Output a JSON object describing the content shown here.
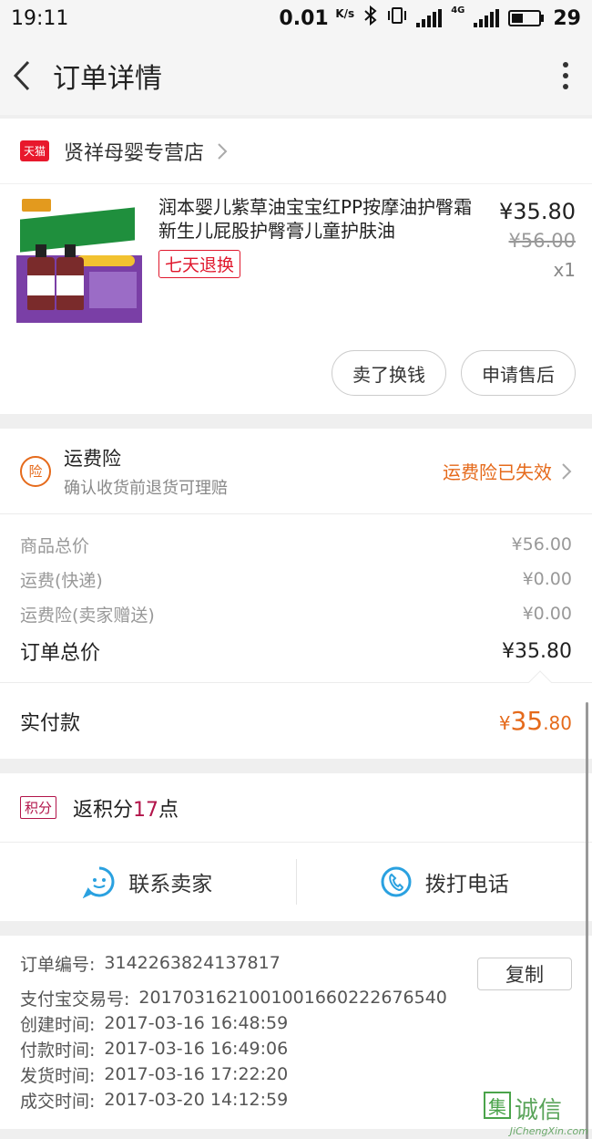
{
  "statusbar": {
    "time": "19:11",
    "speed_value": "0.01",
    "speed_unit": "K/s",
    "network": "4G",
    "battery": "29"
  },
  "header": {
    "title": "订单详情"
  },
  "shop": {
    "badge": "天猫",
    "name": "贤祥母婴专营店"
  },
  "product": {
    "title": "润本婴儿紫草油宝宝红PP按摩油护臀霜新生儿屁股护臀膏儿童护肤油",
    "tag": "七天退换",
    "price": "¥35.80",
    "original_price": "¥56.00",
    "quantity": "x1"
  },
  "actions": {
    "sell": "卖了换钱",
    "after_sale": "申请售后"
  },
  "insurance": {
    "icon_text": "险",
    "title": "运费险",
    "subtitle": "确认收货前退货可理赔",
    "status": "运费险已失效"
  },
  "summary": {
    "rows": [
      {
        "label": "商品总价",
        "value": "¥56.00"
      },
      {
        "label": "运费(快递)",
        "value": "¥0.00"
      },
      {
        "label": "运费险(卖家赠送)",
        "value": "¥0.00"
      }
    ],
    "total_label": "订单总价",
    "total_value": "¥35.80"
  },
  "paid": {
    "label": "实付款",
    "currency": "¥",
    "integer": "35",
    "decimal": ".80"
  },
  "points": {
    "badge": "积分",
    "prefix": "返积分",
    "number": "17",
    "suffix": "点"
  },
  "contact": {
    "seller": "联系卖家",
    "phone": "拨打电话"
  },
  "order_info": {
    "copy_label": "复制",
    "rows": [
      {
        "key": "订单编号:",
        "value": "3142263824137817"
      },
      {
        "key": "支付宝交易号:",
        "value": "2017031621001001660222676540"
      },
      {
        "key": "创建时间:",
        "value": "2017-03-16 16:48:59"
      },
      {
        "key": "付款时间:",
        "value": "2017-03-16 16:49:06"
      },
      {
        "key": "发货时间:",
        "value": "2017-03-16 17:22:20"
      },
      {
        "key": "成交时间:",
        "value": "2017-03-20 14:12:59"
      }
    ]
  },
  "watermark": {
    "text": "集诚信",
    "domain": "JiChengXin.com"
  },
  "colors": {
    "accent_orange": "#e56a1b",
    "tmall_red": "#e8182c",
    "points_red": "#b2144a",
    "contact_blue": "#2aa1e0"
  }
}
